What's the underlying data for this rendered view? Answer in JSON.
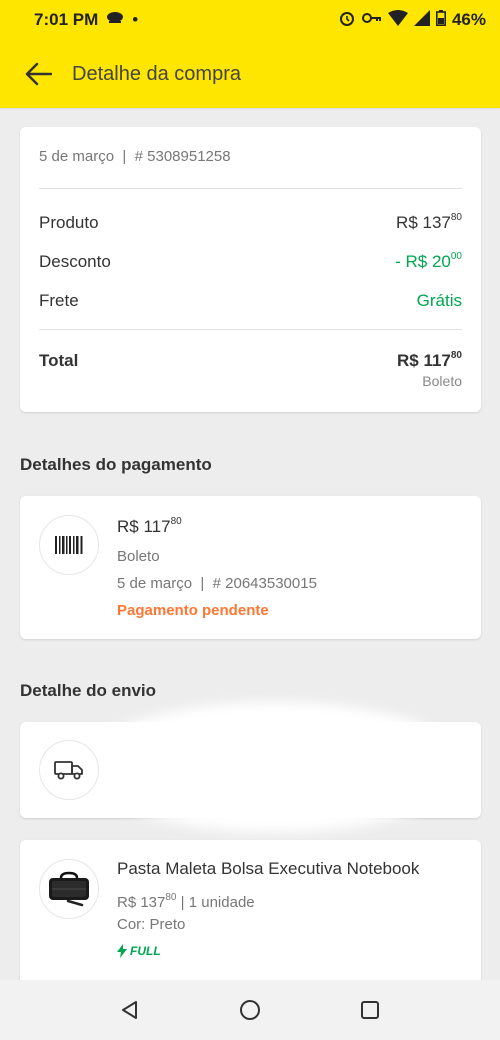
{
  "status_bar": {
    "time": "7:01 PM",
    "dot": "•",
    "battery": "46%",
    "icons": [
      "coffee-icon",
      "alarm-icon",
      "vpn-key-icon",
      "wifi-icon",
      "cell-signal-icon",
      "battery-icon"
    ]
  },
  "header": {
    "title": "Detalhe da compra",
    "bg_color": "#ffe600"
  },
  "summary": {
    "date": "5 de março",
    "separator": "|",
    "order_number": "# 5308951258",
    "rows": [
      {
        "label": "Produto",
        "value_main": "R$ 137",
        "value_cents": "80",
        "color": "#333333"
      },
      {
        "label": "Desconto",
        "value_main": "- R$ 20",
        "value_cents": "00",
        "color": "#00a650"
      },
      {
        "label": "Frete",
        "value_main": "Grátis",
        "value_cents": "",
        "color": "#00a650"
      }
    ],
    "total_label": "Total",
    "total_main": "R$ 117",
    "total_cents": "80",
    "total_method": "Boleto"
  },
  "payment_section": {
    "title": "Detalhes do pagamento",
    "amount_main": "R$ 117",
    "amount_cents": "80",
    "method": "Boleto",
    "date": "5 de março",
    "separator": "|",
    "number": "# 20643530015",
    "status": "Pagamento pendente",
    "status_color": "#ff7733"
  },
  "shipping_section": {
    "title": "Detalhe do envio"
  },
  "product": {
    "name": "Pasta Maleta Bolsa Executiva Notebook",
    "price_main": "R$ 137",
    "price_cents": "80",
    "quantity": "| 1 unidade",
    "color_line": "Cor: Preto",
    "badge": "FULL",
    "badge_color": "#00a650"
  },
  "nav_bar": {
    "icons": [
      "back-triangle-icon",
      "home-circle-icon",
      "recents-square-icon"
    ]
  }
}
